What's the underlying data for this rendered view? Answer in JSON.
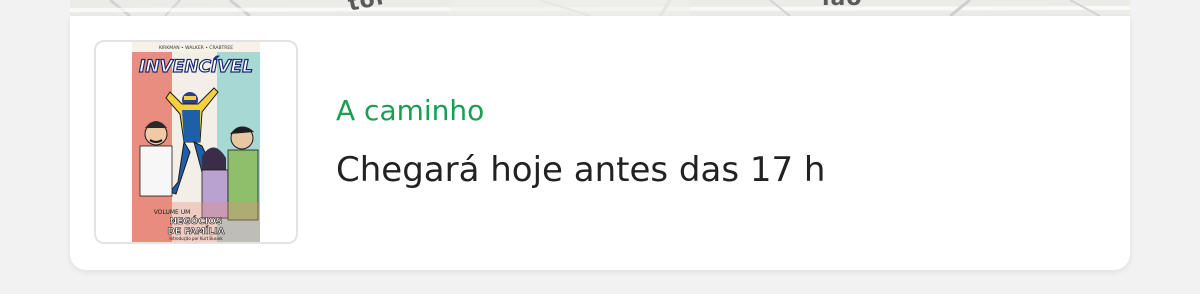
{
  "map": {
    "label_left": "tor",
    "label_right": "ião"
  },
  "delivery": {
    "status": "A caminho",
    "eta": "Chegará hoje antes das 17 h"
  },
  "product": {
    "cover_credits": "KIRKMAN • WALKER • CRABTREE",
    "cover_title": "INVENCÍVEL",
    "cover_volume": "VOLUME UM",
    "cover_subtitle_1": "NEGÓCIOS",
    "cover_subtitle_2": "DE FAMÍLIA",
    "cover_intro": "Introdução por Kurt Busiek"
  },
  "colors": {
    "status_green": "#1a9e54",
    "text_dark": "#222222"
  }
}
